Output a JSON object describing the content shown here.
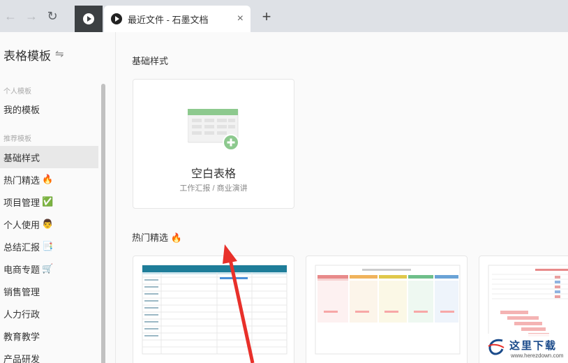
{
  "browser": {
    "back_icon": "←",
    "forward_icon": "→",
    "reload_icon": "↻",
    "tab_title": "最近文件 - 石墨文档",
    "tab_close": "×",
    "new_tab": "+"
  },
  "sidebar": {
    "title": "表格模板",
    "swap_icon": "⇋",
    "section_personal": "个人模板",
    "section_recommended": "推荐模板",
    "items": [
      {
        "label": "我的模板",
        "emoji": ""
      },
      {
        "label": "基础样式",
        "emoji": ""
      },
      {
        "label": "热门精选",
        "emoji": "🔥"
      },
      {
        "label": "项目管理",
        "emoji": "✅"
      },
      {
        "label": "个人使用",
        "emoji": "👨"
      },
      {
        "label": "总结汇报",
        "emoji": "📑"
      },
      {
        "label": "电商专题",
        "emoji": "🛒"
      },
      {
        "label": "销售管理",
        "emoji": ""
      },
      {
        "label": "人力行政",
        "emoji": ""
      },
      {
        "label": "教育教学",
        "emoji": ""
      },
      {
        "label": "产品研发",
        "emoji": ""
      }
    ]
  },
  "main": {
    "basic_heading": "基础样式",
    "blank_card": {
      "title": "空白表格",
      "subtitle": "工作汇报 / 商业演讲"
    },
    "hot_heading": "热门精选",
    "hot_emoji": "🔥"
  },
  "watermark": {
    "text": "这里下载",
    "url": "www.herezdown.com"
  },
  "colors": {
    "accent_green": "#8dc98e",
    "tab_dark": "#3c4043",
    "arrow_red": "#e8302a"
  }
}
